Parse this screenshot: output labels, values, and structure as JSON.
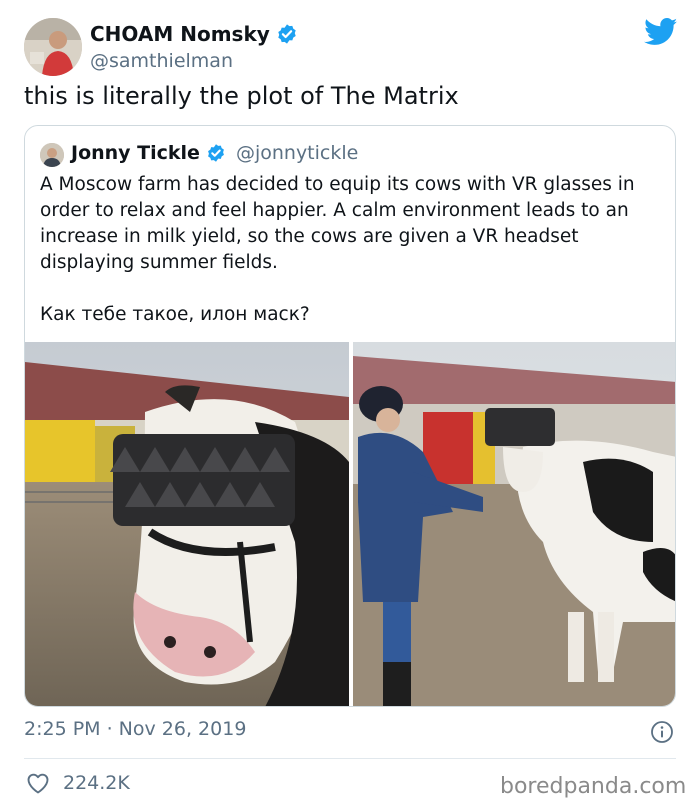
{
  "tweet": {
    "author_name": "CHOAM Nomsky",
    "author_handle": "@samthielman",
    "text": "this is literally the plot of The Matrix",
    "timestamp": "2:25 PM · Nov 26, 2019",
    "likes": "224.2K"
  },
  "quote": {
    "author_name": "Jonny Tickle",
    "author_handle": "@jonnytickle",
    "text": "A Moscow farm has decided to equip its cows with VR glasses in order to relax and feel happier. A calm environment leads to an increase in milk yield, so the cows are given a VR headset displaying summer fields.",
    "text_ru": "Как тебе такое, илон маск?"
  },
  "watermark": "boredpanda.com",
  "colors": {
    "verified": "#1da1f2",
    "twitter_bird": "#1da1f2",
    "secondary_text": "#5b7083"
  },
  "icons": [
    "verified-badge-icon",
    "twitter-bird-icon",
    "info-icon",
    "heart-icon"
  ]
}
